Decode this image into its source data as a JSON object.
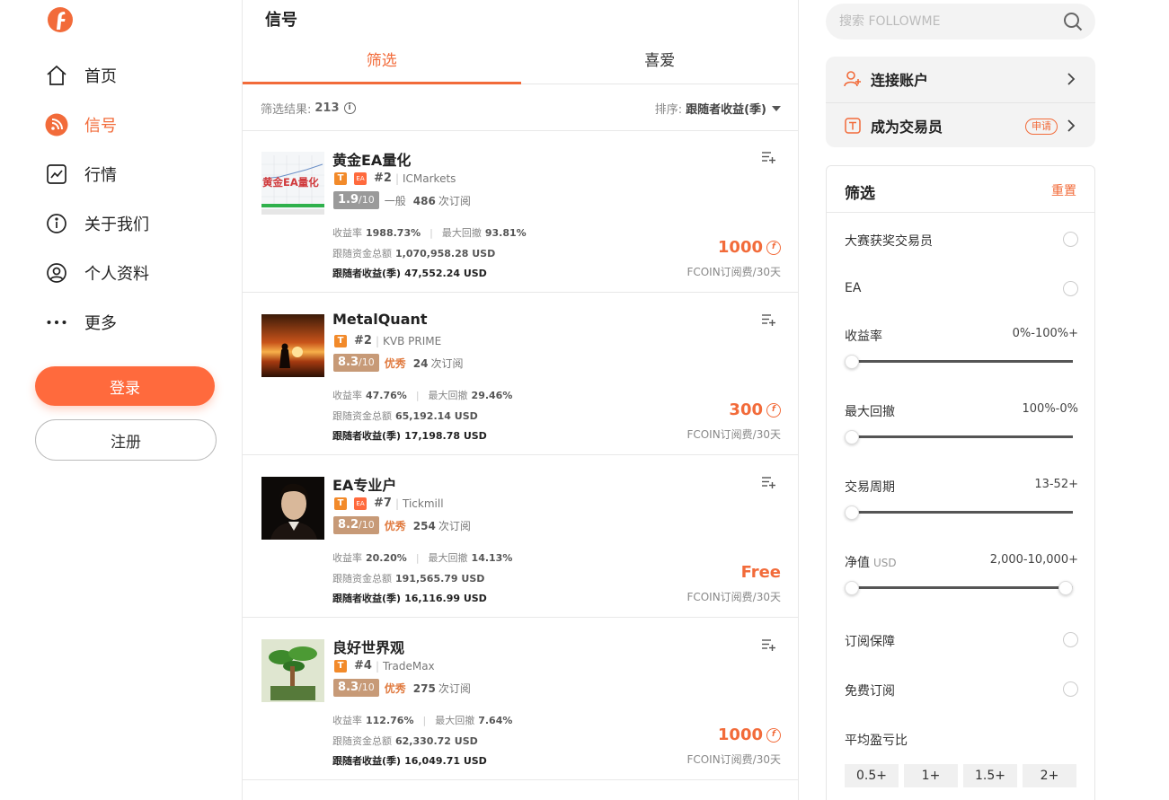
{
  "nav": {
    "logo_icon": "followme-logo-icon",
    "items": [
      {
        "label": "首页",
        "icon": "home-icon"
      },
      {
        "label": "信号",
        "icon": "rss-icon"
      },
      {
        "label": "行情",
        "icon": "chart-icon"
      },
      {
        "label": "关于我们",
        "icon": "info-icon"
      },
      {
        "label": "个人资料",
        "icon": "user-icon"
      },
      {
        "label": "更多",
        "icon": "more-icon"
      }
    ],
    "active_index": 1,
    "login": "登录",
    "register": "注册"
  },
  "main": {
    "title": "信号",
    "tabs": [
      {
        "label": "筛选"
      },
      {
        "label": "喜爱"
      }
    ],
    "results_label": "筛选结果:",
    "results_count": "213",
    "sort_label": "排序:",
    "sort_value": "跟随者收益(季)",
    "labels": {
      "return": "收益率",
      "drawdown": "最大回撤",
      "funds": "跟随资金总额",
      "follower_profit": "跟随者收益(季)",
      "subs_suffix": "次订阅",
      "score_suffix": "/10",
      "fee": "FCOIN订阅费/30天"
    },
    "signals": [
      {
        "name": "黄金EA量化",
        "has_ea": true,
        "rank": "#2",
        "broker": "ICMarkets",
        "score": "1.9",
        "level": "一般",
        "subs": "486",
        "return": "1988.73%",
        "drawdown": "93.81%",
        "funds": "1,070,958.28 USD",
        "profit": "47,552.24 USD",
        "price": "1000",
        "thumb_text": "黄金EA量化"
      },
      {
        "name": "MetalQuant",
        "has_ea": false,
        "rank": "#2",
        "broker": "KVB PRIME",
        "score": "8.3",
        "level": "优秀",
        "subs": "24",
        "return": "47.76%",
        "drawdown": "29.46%",
        "funds": "65,192.14 USD",
        "profit": "17,198.78 USD",
        "price": "300"
      },
      {
        "name": "EA专业户",
        "has_ea": true,
        "rank": "#7",
        "broker": "Tickmill",
        "score": "8.2",
        "level": "优秀",
        "subs": "254",
        "return": "20.20%",
        "drawdown": "14.13%",
        "funds": "191,565.79 USD",
        "profit": "16,116.99 USD",
        "price": "Free"
      },
      {
        "name": "良好世界观",
        "has_ea": false,
        "rank": "#4",
        "broker": "TradeMax",
        "score": "8.3",
        "level": "优秀",
        "subs": "275",
        "return": "112.76%",
        "drawdown": "7.64%",
        "funds": "62,330.72 USD",
        "profit": "16,049.71 USD",
        "price": "1000"
      }
    ]
  },
  "side": {
    "search_placeholder": "搜索 FOLLOWME",
    "connect": "连接账户",
    "become_trader": "成为交易员",
    "apply_badge": "申请",
    "filter": {
      "title": "筛选",
      "reset": "重置",
      "award": "大赛获奖交易员",
      "ea": "EA",
      "return": {
        "label": "收益率",
        "range": "0%-100%+",
        "min": 0,
        "max": 0
      },
      "drawdown": {
        "label": "最大回撤",
        "range": "100%-0%",
        "min": 0,
        "max": 0
      },
      "period": {
        "label": "交易周期",
        "range": "13-52+",
        "min": 0,
        "max": 0
      },
      "equity": {
        "label": "净值",
        "unit": "USD",
        "range": "2,000-10,000+",
        "min": 0,
        "max": 1
      },
      "guarantee": "订阅保障",
      "free": "免费订阅",
      "ratio_label": "平均盈亏比",
      "ratio_options": [
        "0.5+",
        "1+",
        "1.5+",
        "2+"
      ]
    }
  }
}
